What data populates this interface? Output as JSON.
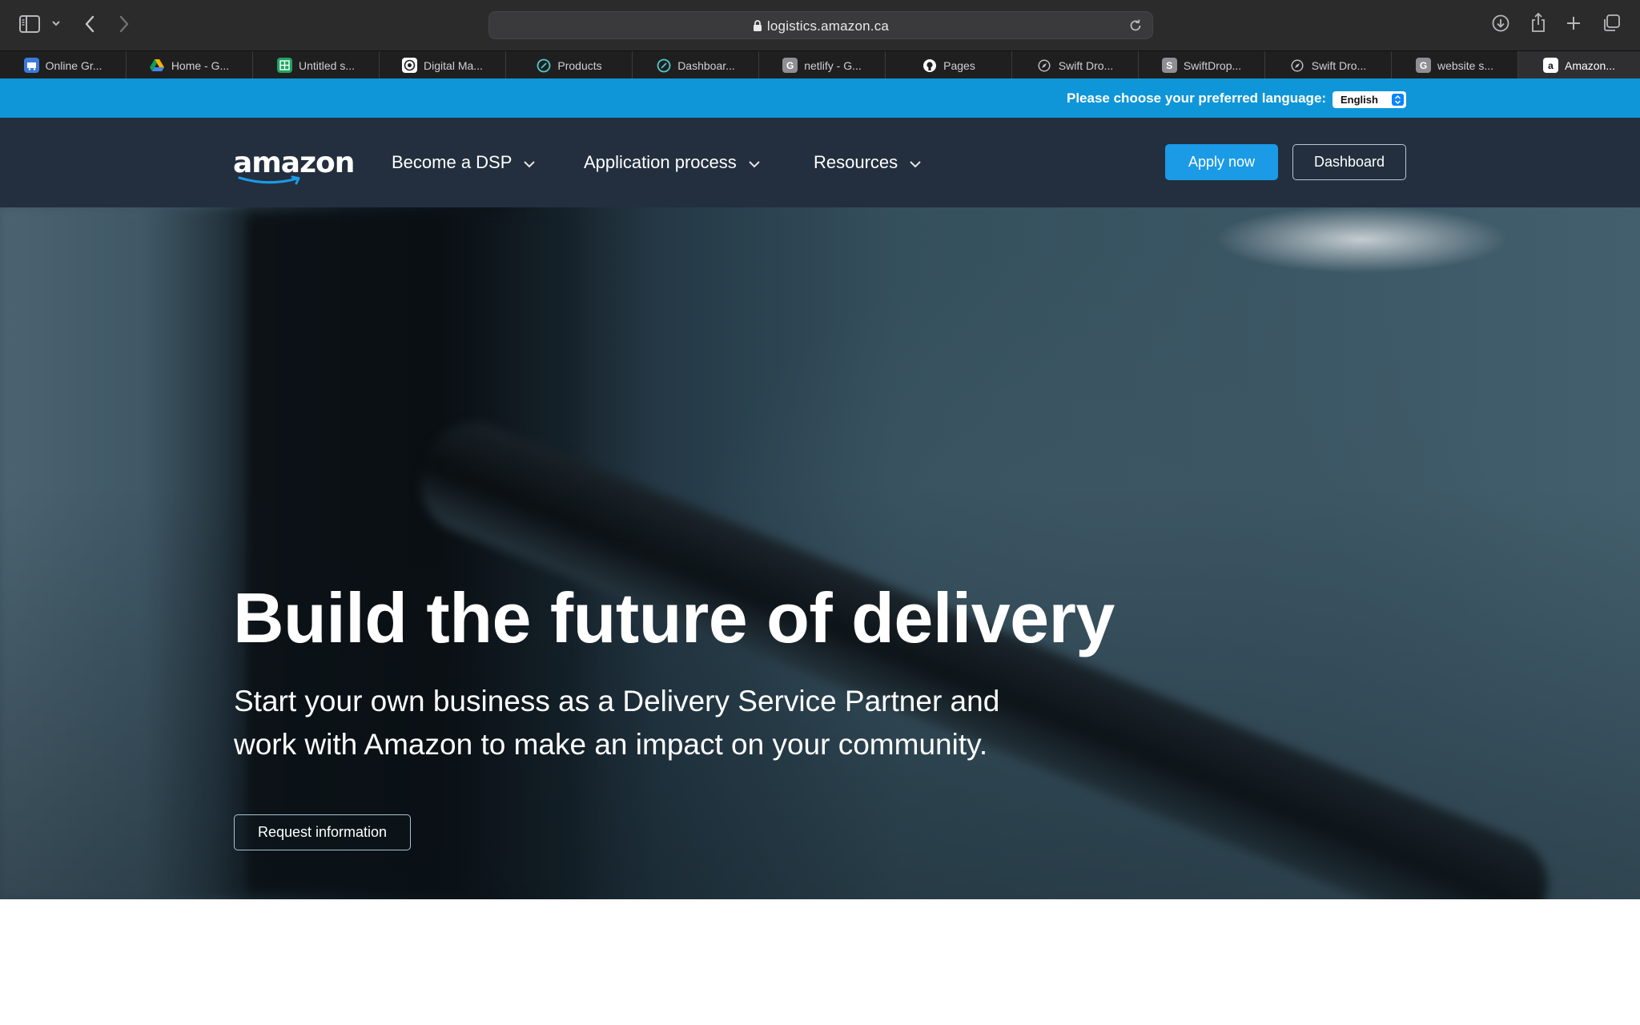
{
  "browser": {
    "url": "logistics.amazon.ca",
    "tabs": [
      {
        "label": "Online Gr...",
        "icon": "online-grocery-favicon",
        "color": "#3b7bd8"
      },
      {
        "label": "Home - G...",
        "icon": "google-drive-favicon",
        "color": "#f4b400"
      },
      {
        "label": "Untitled s...",
        "icon": "google-sheets-favicon",
        "color": "#1fa463"
      },
      {
        "label": "Digital Ma...",
        "icon": "digital-marketing-favicon",
        "color": "#ffffff"
      },
      {
        "label": "Products",
        "icon": "netlify-favicon",
        "color": "#52c8c8"
      },
      {
        "label": "Dashboar...",
        "icon": "netlify-favicon",
        "color": "#52c8c8"
      },
      {
        "label": "netlify - G...",
        "icon": "google-g-favicon",
        "color": "#8e8e93"
      },
      {
        "label": "Pages",
        "icon": "github-favicon",
        "color": "#ffffff"
      },
      {
        "label": "Swift Dro...",
        "icon": "compass-favicon",
        "color": "#c7c7cc"
      },
      {
        "label": "SwiftDrop...",
        "icon": "s-letter-favicon",
        "color": "#8e8e93"
      },
      {
        "label": "Swift Dro...",
        "icon": "compass-favicon",
        "color": "#c7c7cc"
      },
      {
        "label": "website s...",
        "icon": "google-g-favicon",
        "color": "#8e8e93"
      },
      {
        "label": "Amazon...",
        "icon": "amazon-favicon",
        "color": "#ffffff",
        "active": true
      }
    ]
  },
  "langbar": {
    "label": "Please choose your preferred language:",
    "selected": "English"
  },
  "nav": {
    "logo": "amazon",
    "items": [
      {
        "label": "Become a DSP"
      },
      {
        "label": "Application process"
      },
      {
        "label": "Resources"
      }
    ],
    "apply_label": "Apply now",
    "dashboard_label": "Dashboard"
  },
  "hero": {
    "title": "Build the future of delivery",
    "subtitle_line1": "Start your own business as a Delivery Service Partner and",
    "subtitle_line2": "work with Amazon to make an impact on your community.",
    "cta_label": "Request information"
  },
  "colors": {
    "accent": "#1b9ae6",
    "langbar": "#0f96d8",
    "nav_bg": "#232f3e",
    "amazon_smile": "#ff9900"
  }
}
